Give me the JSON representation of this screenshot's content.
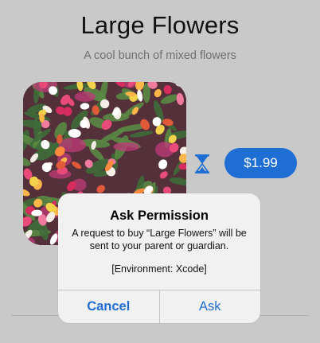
{
  "product": {
    "title": "Large Flowers",
    "subtitle": "A cool bunch of mixed flowers",
    "price_label": "$1.99",
    "image_icon": "flower-bouquet-image",
    "status_icon": "hourglass-icon"
  },
  "alert": {
    "title": "Ask Permission",
    "message": "A request to buy “Large Flowers” will be sent to your parent or guardian.",
    "environment": "[Environment: Xcode]",
    "cancel_label": "Cancel",
    "ask_label": "Ask"
  },
  "colors": {
    "accent": "#1f6ed4",
    "background": "#c9c9c9",
    "alert_background": "#f1f1f1"
  }
}
